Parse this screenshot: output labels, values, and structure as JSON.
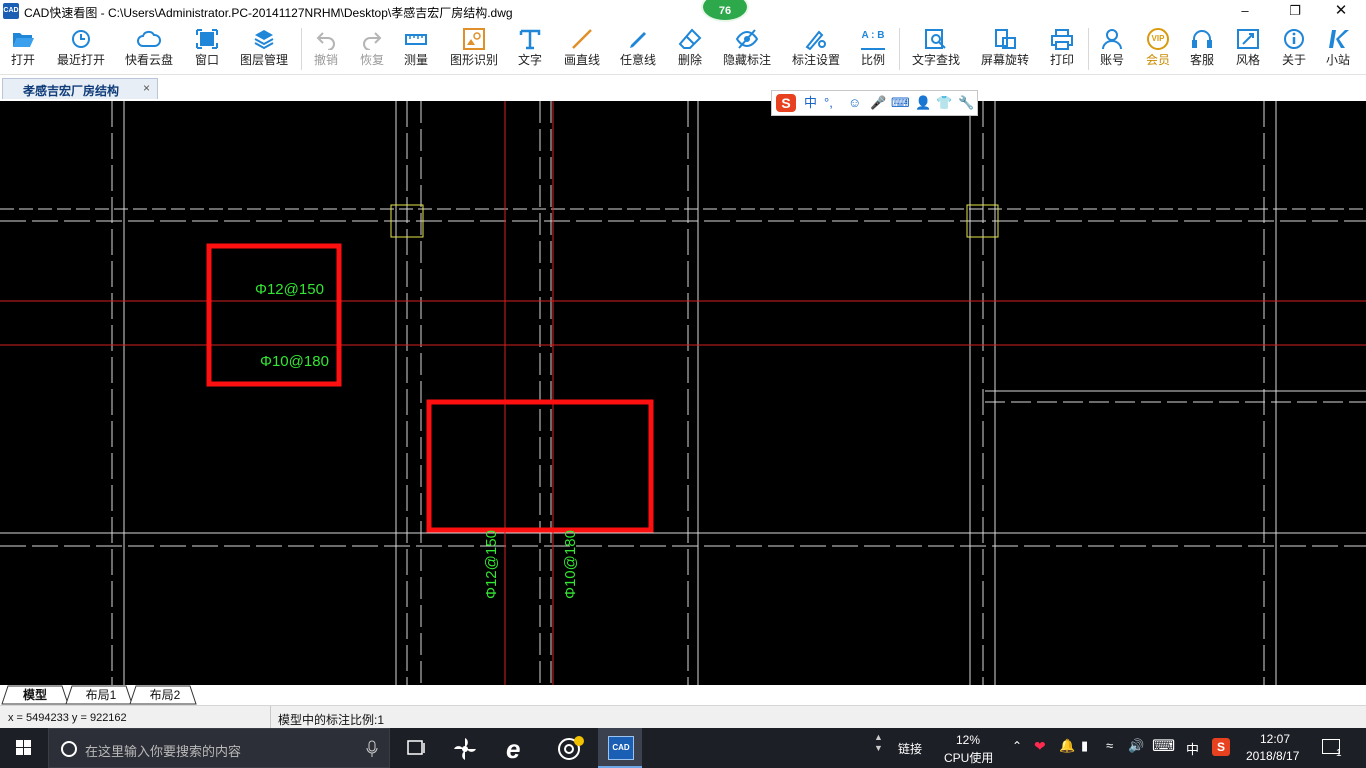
{
  "window": {
    "title": "CAD快速看图 - C:\\Users\\Administrator.PC-20141127NRHM\\Desktop\\孝感吉宏厂房结构.dwg",
    "app_icon_text": "CAD",
    "badge": "76"
  },
  "toolbar": [
    {
      "id": "open",
      "label": "打开",
      "icon": "folder-open-icon",
      "enabled": true
    },
    {
      "id": "recent",
      "label": "最近打开",
      "icon": "clock-icon",
      "enabled": true
    },
    {
      "id": "cloud",
      "label": "快看云盘",
      "icon": "cloud-icon",
      "enabled": true
    },
    {
      "id": "window",
      "label": "窗口",
      "icon": "window-icon",
      "enabled": true
    },
    {
      "id": "layers",
      "label": "图层管理",
      "icon": "layers-icon",
      "enabled": true
    },
    {
      "id": "undo",
      "label": "撤销",
      "icon": "undo-icon",
      "enabled": false
    },
    {
      "id": "redo",
      "label": "恢复",
      "icon": "redo-icon",
      "enabled": false
    },
    {
      "id": "measure",
      "label": "测量",
      "icon": "ruler-icon",
      "enabled": true
    },
    {
      "id": "shape",
      "label": "图形识别",
      "icon": "shape-recognize-icon",
      "enabled": true
    },
    {
      "id": "text",
      "label": "文字",
      "icon": "text-icon",
      "enabled": true
    },
    {
      "id": "line",
      "label": "画直线",
      "icon": "line-icon",
      "enabled": true
    },
    {
      "id": "freeline",
      "label": "任意线",
      "icon": "pen-icon",
      "enabled": true
    },
    {
      "id": "erase",
      "label": "删除",
      "icon": "eraser-icon",
      "enabled": true
    },
    {
      "id": "hide",
      "label": "隐藏标注",
      "icon": "eye-hide-icon",
      "enabled": true
    },
    {
      "id": "annset",
      "label": "标注设置",
      "icon": "annotation-settings-icon",
      "enabled": true
    },
    {
      "id": "ratio",
      "label": "比例",
      "icon": "ratio-icon",
      "enabled": true
    },
    {
      "id": "find",
      "label": "文字查找",
      "icon": "text-search-icon",
      "enabled": true
    },
    {
      "id": "rotate",
      "label": "屏幕旋转",
      "icon": "rotate-screen-icon",
      "enabled": true
    },
    {
      "id": "print",
      "label": "打印",
      "icon": "printer-icon",
      "enabled": true
    },
    {
      "id": "account",
      "label": "账号",
      "icon": "user-icon",
      "enabled": true
    },
    {
      "id": "vip",
      "label": "会员",
      "icon": "vip-icon",
      "enabled": true
    },
    {
      "id": "service",
      "label": "客服",
      "icon": "headset-icon",
      "enabled": true
    },
    {
      "id": "style",
      "label": "风格",
      "icon": "style-icon",
      "enabled": true
    },
    {
      "id": "about",
      "label": "关于",
      "icon": "info-icon",
      "enabled": true
    },
    {
      "id": "site",
      "label": "小站",
      "icon": "k-logo-icon",
      "enabled": true
    }
  ],
  "ratio_icon_text": "A : B",
  "vip_icon_text": "VIP",
  "tab": {
    "label": "孝感吉宏厂房结构",
    "close": "×"
  },
  "ime": {
    "logo": "S",
    "mode": "中",
    "punct": "°,"
  },
  "drawing": {
    "annotations": [
      {
        "text": "Φ12@150",
        "orientation": "horizontal"
      },
      {
        "text": "Φ10@180",
        "orientation": "horizontal"
      },
      {
        "text": "Φ12@150",
        "orientation": "vertical"
      },
      {
        "text": "Φ10@180",
        "orientation": "vertical"
      }
    ],
    "colors": {
      "annotation": "#33e633",
      "highlight": "#ff1010",
      "axis": "#d61f1f",
      "grid": "#d9d9d9",
      "column": "#e6e64d"
    }
  },
  "layout_tabs": [
    "模型",
    "布局1",
    "布局2"
  ],
  "status": {
    "coords": "x = 5494233  y = 922162",
    "scale": "模型中的标注比例:1"
  },
  "taskbar": {
    "search_placeholder": "在这里输入你要搜索的内容",
    "cad_icon_text": "CAD",
    "link": "链接",
    "cpu_percent": "12%",
    "cpu_label": "CPU使用",
    "ime": "中",
    "time": "12:07",
    "date": "2018/8/17",
    "notif": "1"
  }
}
